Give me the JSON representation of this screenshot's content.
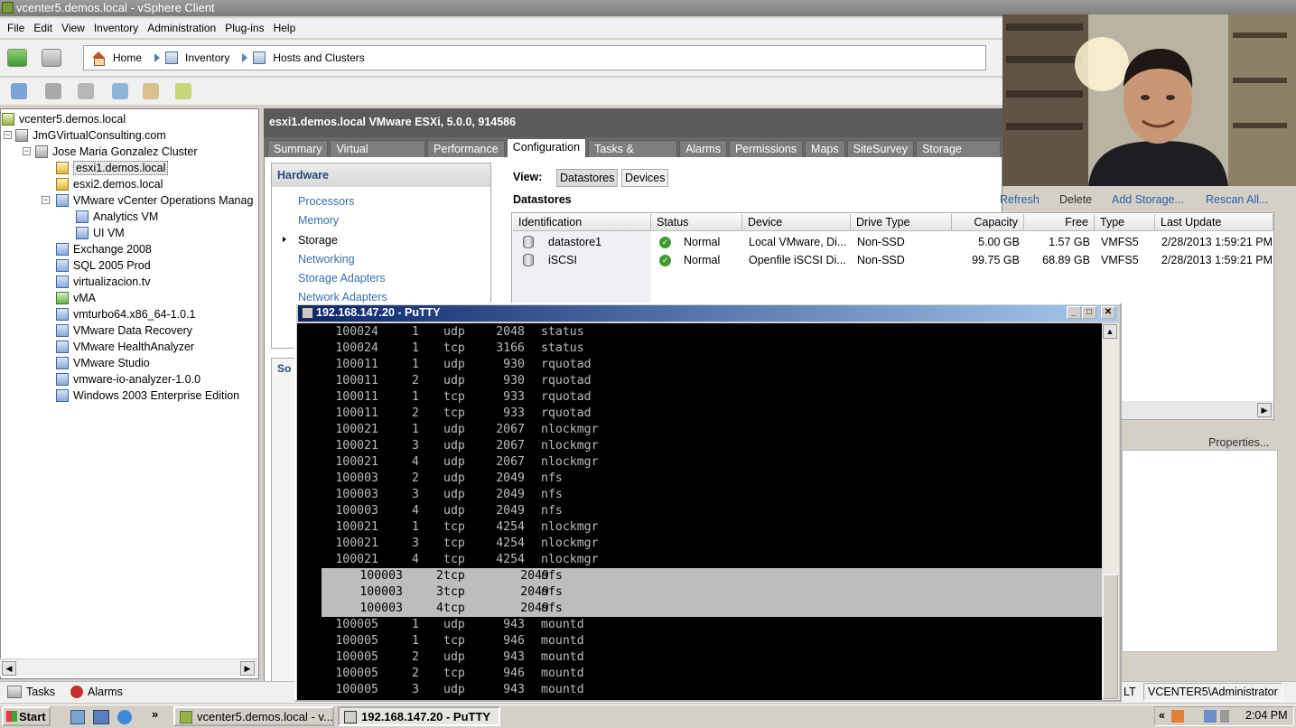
{
  "window": {
    "title": "vcenter5.demos.local - vSphere Client"
  },
  "menu": [
    "File",
    "Edit",
    "View",
    "Inventory",
    "Administration",
    "Plug-ins",
    "Help"
  ],
  "breadcrumb": {
    "home": "Home",
    "inventory": "Inventory",
    "current": "Hosts and Clusters"
  },
  "tree": {
    "root": "vcenter5.demos.local",
    "datacenter": "JmGVirtualConsulting.com",
    "cluster": "Jose Maria Gonzalez Cluster",
    "host1": "esxi1.demos.local",
    "host2": "esxi2.demos.local",
    "vapp": "VMware vCenter Operations Manag",
    "vapp_children": [
      "Analytics VM",
      "UI VM"
    ],
    "vms": [
      "Exchange 2008",
      "SQL 2005 Prod",
      "virtualizacion.tv",
      "vMA",
      "vmturbo64.x86_64-1.0.1",
      "VMware Data Recovery",
      "VMware HealthAnalyzer",
      "VMware Studio",
      "vmware-io-analyzer-1.0.0",
      "Windows 2003 Enterprise Edition"
    ]
  },
  "host_header": "esxi1.demos.local VMware ESXi, 5.0.0, 914586",
  "tabs": [
    "Summary",
    "Virtual Machines",
    "Performance",
    "Configuration",
    "Tasks & Events",
    "Alarms",
    "Permissions",
    "Maps",
    "SiteSurvey",
    "Storage Views"
  ],
  "active_tab": "Configuration",
  "hardware": {
    "title": "Hardware",
    "items": [
      "Processors",
      "Memory",
      "Storage",
      "Networking",
      "Storage Adapters",
      "Network Adapters"
    ],
    "selected": "Storage"
  },
  "software_title": "So",
  "view": {
    "label": "View:",
    "options": [
      "Datastores",
      "Devices"
    ],
    "selected": "Datastores"
  },
  "datastores": {
    "title": "Datastores",
    "actions": [
      "Refresh",
      "Delete",
      "Add Storage...",
      "Rescan All..."
    ],
    "columns": [
      "Identification",
      "Status",
      "Device",
      "Drive Type",
      "Capacity",
      "Free",
      "Type",
      "Last Update"
    ],
    "rows": [
      [
        "datastore1",
        "Normal",
        "Local VMware, Di...",
        "Non-SSD",
        "5.00 GB",
        "1.57 GB",
        "VMFS5",
        "2/28/2013 1:59:21 PM"
      ],
      [
        "iSCSI",
        "Normal",
        "Openfile iSCSI Di...",
        "Non-SSD",
        "99.75 GB",
        "68.89 GB",
        "VMFS5",
        "2/28/2013 1:59:21 PM"
      ]
    ],
    "properties_link": "Properties..."
  },
  "statusbar": {
    "tasks": "Tasks",
    "alarms": "Alarms",
    "user_prefix": "LT",
    "user": "VCENTER5\\Administrator"
  },
  "putty": {
    "title": "192.168.147.20 - PuTTY",
    "lines": [
      [
        "100024",
        "1",
        "udp",
        "2048",
        "status"
      ],
      [
        "100024",
        "1",
        "tcp",
        "3166",
        "status"
      ],
      [
        "100011",
        "1",
        "udp",
        "930",
        "rquotad"
      ],
      [
        "100011",
        "2",
        "udp",
        "930",
        "rquotad"
      ],
      [
        "100011",
        "1",
        "tcp",
        "933",
        "rquotad"
      ],
      [
        "100011",
        "2",
        "tcp",
        "933",
        "rquotad"
      ],
      [
        "100021",
        "1",
        "udp",
        "2067",
        "nlockmgr"
      ],
      [
        "100021",
        "3",
        "udp",
        "2067",
        "nlockmgr"
      ],
      [
        "100021",
        "4",
        "udp",
        "2067",
        "nlockmgr"
      ],
      [
        "100003",
        "2",
        "udp",
        "2049",
        "nfs"
      ],
      [
        "100003",
        "3",
        "udp",
        "2049",
        "nfs"
      ],
      [
        "100003",
        "4",
        "udp",
        "2049",
        "nfs"
      ],
      [
        "100021",
        "1",
        "tcp",
        "4254",
        "nlockmgr"
      ],
      [
        "100021",
        "3",
        "tcp",
        "4254",
        "nlockmgr"
      ],
      [
        "100021",
        "4",
        "tcp",
        "4254",
        "nlockmgr"
      ],
      [
        "100003",
        "2",
        "tcp",
        "2049",
        "nfs"
      ],
      [
        "100003",
        "3",
        "tcp",
        "2049",
        "nfs"
      ],
      [
        "100003",
        "4",
        "tcp",
        "2049",
        "nfs"
      ],
      [
        "100005",
        "1",
        "udp",
        "943",
        "mountd"
      ],
      [
        "100005",
        "1",
        "tcp",
        "946",
        "mountd"
      ],
      [
        "100005",
        "2",
        "udp",
        "943",
        "mountd"
      ],
      [
        "100005",
        "2",
        "tcp",
        "946",
        "mountd"
      ],
      [
        "100005",
        "3",
        "udp",
        "943",
        "mountd"
      ]
    ],
    "selected_lines": [
      15,
      16,
      17
    ]
  },
  "taskbar": {
    "start": "Start",
    "buttons": [
      "vcenter5.demos.local - v...",
      "192.168.147.20 - PuTTY"
    ],
    "chevron": "»",
    "clock": "2:04 PM",
    "tray_chevron": "«"
  }
}
